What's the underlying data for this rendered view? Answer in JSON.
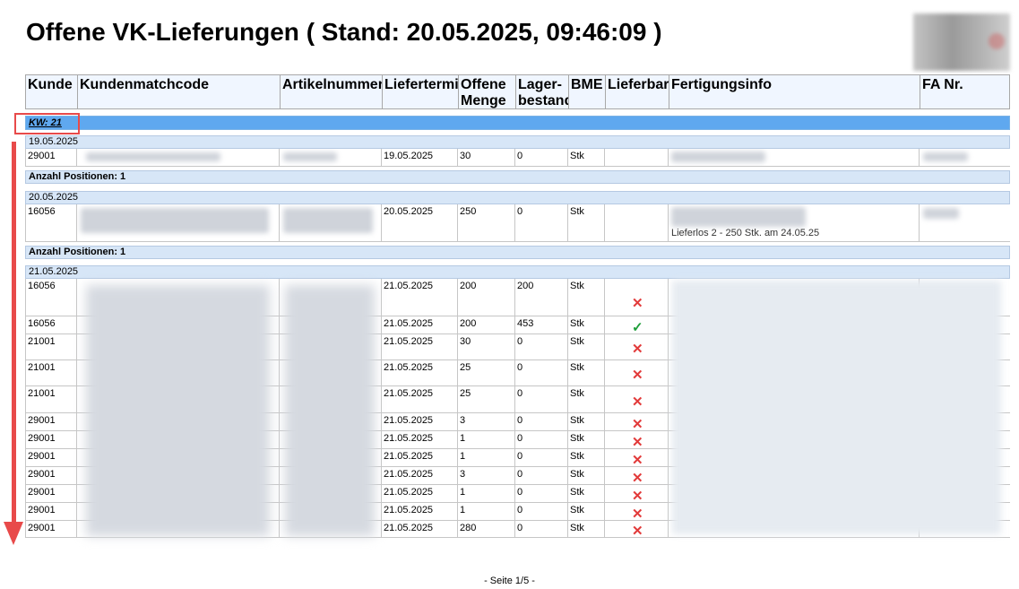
{
  "title": "Offene VK-Lieferungen ( Stand: 20.05.2025, 09:46:09 )",
  "columns": {
    "kunde": "Kunde",
    "kundenmatchcode": "Kundenmatchcode",
    "artikelnummer": "Artikelnummer",
    "liefertermin": "Liefertermin",
    "offene_menge": "Offene Menge",
    "lagerbestand": "Lager-bestand",
    "bme": "BME",
    "lieferbar": "Lieferbar",
    "fertigungsinfo": "Fertigungsinfo",
    "fa_nr": "FA Nr."
  },
  "week_label": "KW: 21",
  "groups": [
    {
      "date": "19.05.2025",
      "count_label": "Anzahl Positionen: 1",
      "rows": [
        {
          "kunde": "29001",
          "liefertermin": "19.05.2025",
          "menge": "30",
          "lager": "0",
          "bme": "Stk",
          "lieferbar": ""
        }
      ]
    },
    {
      "date": "20.05.2025",
      "count_label": "Anzahl Positionen: 1",
      "rows": [
        {
          "kunde": "16056",
          "liefertermin": "20.05.2025",
          "menge": "250",
          "lager": "0",
          "bme": "Stk",
          "lieferbar": "",
          "info": "Lieferlos 2 - 250 Stk. am 24.05.25"
        }
      ]
    },
    {
      "date": "21.05.2025",
      "rows": [
        {
          "kunde": "16056",
          "liefertermin": "21.05.2025",
          "menge": "200",
          "lager": "200",
          "bme": "Stk",
          "lieferbar": "no"
        },
        {
          "kunde": "16056",
          "liefertermin": "21.05.2025",
          "menge": "200",
          "lager": "453",
          "bme": "Stk",
          "lieferbar": "yes"
        },
        {
          "kunde": "21001",
          "liefertermin": "21.05.2025",
          "menge": "30",
          "lager": "0",
          "bme": "Stk",
          "lieferbar": "no"
        },
        {
          "kunde": "21001",
          "liefertermin": "21.05.2025",
          "menge": "25",
          "lager": "0",
          "bme": "Stk",
          "lieferbar": "no"
        },
        {
          "kunde": "21001",
          "liefertermin": "21.05.2025",
          "menge": "25",
          "lager": "0",
          "bme": "Stk",
          "lieferbar": "no"
        },
        {
          "kunde": "29001",
          "liefertermin": "21.05.2025",
          "menge": "3",
          "lager": "0",
          "bme": "Stk",
          "lieferbar": "no"
        },
        {
          "kunde": "29001",
          "liefertermin": "21.05.2025",
          "menge": "1",
          "lager": "0",
          "bme": "Stk",
          "lieferbar": "no"
        },
        {
          "kunde": "29001",
          "liefertermin": "21.05.2025",
          "menge": "1",
          "lager": "0",
          "bme": "Stk",
          "lieferbar": "no"
        },
        {
          "kunde": "29001",
          "liefertermin": "21.05.2025",
          "menge": "3",
          "lager": "0",
          "bme": "Stk",
          "lieferbar": "no"
        },
        {
          "kunde": "29001",
          "liefertermin": "21.05.2025",
          "menge": "1",
          "lager": "0",
          "bme": "Stk",
          "lieferbar": "no"
        },
        {
          "kunde": "29001",
          "liefertermin": "21.05.2025",
          "menge": "1",
          "lager": "0",
          "bme": "Stk",
          "lieferbar": "no"
        },
        {
          "kunde": "29001",
          "liefertermin": "21.05.2025",
          "menge": "280",
          "lager": "0",
          "bme": "Stk",
          "lieferbar": "no"
        }
      ]
    }
  ],
  "status_icons": {
    "no": "cross-icon",
    "yes": "check-icon"
  },
  "colors": {
    "header_bg": "#f0f6ff",
    "week_bar": "#5fa8ef",
    "date_band": "#d7e6f7",
    "annotation": "#e84a4a",
    "cross": "#e23a3a",
    "check": "#1e9e3a"
  },
  "footer": "- Seite 1/5 -"
}
